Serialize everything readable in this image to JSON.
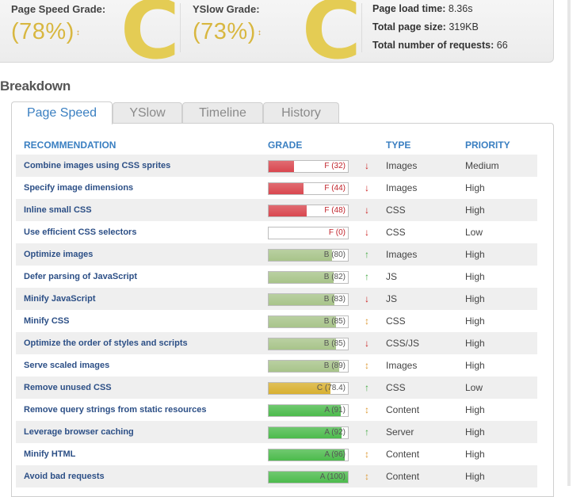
{
  "summary": {
    "pagespeed": {
      "label": "Page Speed Grade:",
      "percent": "(78%)",
      "letter": "C",
      "arrow": "↕"
    },
    "yslow": {
      "label": "YSlow Grade:",
      "percent": "(73%)",
      "letter": "C",
      "arrow": "↕"
    },
    "stats": {
      "load_time_label": "Page load time:",
      "load_time_value": "8.36s",
      "page_size_label": "Total page size:",
      "page_size_value": "319KB",
      "requests_label": "Total number of requests:",
      "requests_value": "66"
    }
  },
  "breakdown": {
    "title": "Breakdown",
    "tabs": [
      {
        "label": "Page Speed",
        "active": true
      },
      {
        "label": "YSlow",
        "active": false
      },
      {
        "label": "Timeline",
        "active": false
      },
      {
        "label": "History",
        "active": false
      }
    ],
    "columns": {
      "recommendation": "RECOMMENDATION",
      "grade": "GRADE",
      "type": "TYPE",
      "priority": "PRIORITY"
    },
    "colors": {
      "red": "#d9474f",
      "green_light": "#a8c48a",
      "amber": "#d8b030",
      "green": "#4cbb4c",
      "arrow_down": "#cc2222",
      "arrow_up": "#44aa44",
      "arrow_neutral": "#dd9933"
    },
    "rows": [
      {
        "recommendation": "Combine images using CSS sprites",
        "grade_text": "F (32)",
        "score": 32,
        "color": "red",
        "trend": "↓",
        "trend_color": "arrow_down",
        "type": "Images",
        "priority": "Medium"
      },
      {
        "recommendation": "Specify image dimensions",
        "grade_text": "F (44)",
        "score": 44,
        "color": "red",
        "trend": "↓",
        "trend_color": "arrow_down",
        "type": "Images",
        "priority": "High"
      },
      {
        "recommendation": "Inline small CSS",
        "grade_text": "F (48)",
        "score": 48,
        "color": "red",
        "trend": "↓",
        "trend_color": "arrow_down",
        "type": "CSS",
        "priority": "High"
      },
      {
        "recommendation": "Use efficient CSS selectors",
        "grade_text": "F (0)",
        "score": 0,
        "color": "red",
        "trend": "↓",
        "trend_color": "arrow_down",
        "type": "CSS",
        "priority": "Low"
      },
      {
        "recommendation": "Optimize images",
        "grade_text": "B (80)",
        "score": 80,
        "color": "green_light",
        "trend": "↑",
        "trend_color": "arrow_up",
        "type": "Images",
        "priority": "High"
      },
      {
        "recommendation": "Defer parsing of JavaScript",
        "grade_text": "B (82)",
        "score": 82,
        "color": "green_light",
        "trend": "↑",
        "trend_color": "arrow_up",
        "type": "JS",
        "priority": "High"
      },
      {
        "recommendation": "Minify JavaScript",
        "grade_text": "B (83)",
        "score": 83,
        "color": "green_light",
        "trend": "↓",
        "trend_color": "arrow_down",
        "type": "JS",
        "priority": "High"
      },
      {
        "recommendation": "Minify CSS",
        "grade_text": "B (85)",
        "score": 85,
        "color": "green_light",
        "trend": "↕",
        "trend_color": "arrow_neutral",
        "type": "CSS",
        "priority": "High"
      },
      {
        "recommendation": "Optimize the order of styles and scripts",
        "grade_text": "B (85)",
        "score": 85,
        "color": "green_light",
        "trend": "↓",
        "trend_color": "arrow_down",
        "type": "CSS/JS",
        "priority": "High"
      },
      {
        "recommendation": "Serve scaled images",
        "grade_text": "B (89)",
        "score": 89,
        "color": "green_light",
        "trend": "↕",
        "trend_color": "arrow_neutral",
        "type": "Images",
        "priority": "High"
      },
      {
        "recommendation": "Remove unused CSS",
        "grade_text": "C (78.4)",
        "score": 78.4,
        "color": "amber",
        "trend": "↑",
        "trend_color": "arrow_up",
        "type": "CSS",
        "priority": "Low"
      },
      {
        "recommendation": "Remove query strings from static resources",
        "grade_text": "A (91)",
        "score": 91,
        "color": "green",
        "trend": "↕",
        "trend_color": "arrow_neutral",
        "type": "Content",
        "priority": "High"
      },
      {
        "recommendation": "Leverage browser caching",
        "grade_text": "A (92)",
        "score": 92,
        "color": "green",
        "trend": "↑",
        "trend_color": "arrow_up",
        "type": "Server",
        "priority": "High"
      },
      {
        "recommendation": "Minify HTML",
        "grade_text": "A (96)",
        "score": 96,
        "color": "green",
        "trend": "↕",
        "trend_color": "arrow_neutral",
        "type": "Content",
        "priority": "High"
      },
      {
        "recommendation": "Avoid bad requests",
        "grade_text": "A (100)",
        "score": 100,
        "color": "green",
        "trend": "↕",
        "trend_color": "arrow_neutral",
        "type": "Content",
        "priority": "High"
      }
    ]
  }
}
